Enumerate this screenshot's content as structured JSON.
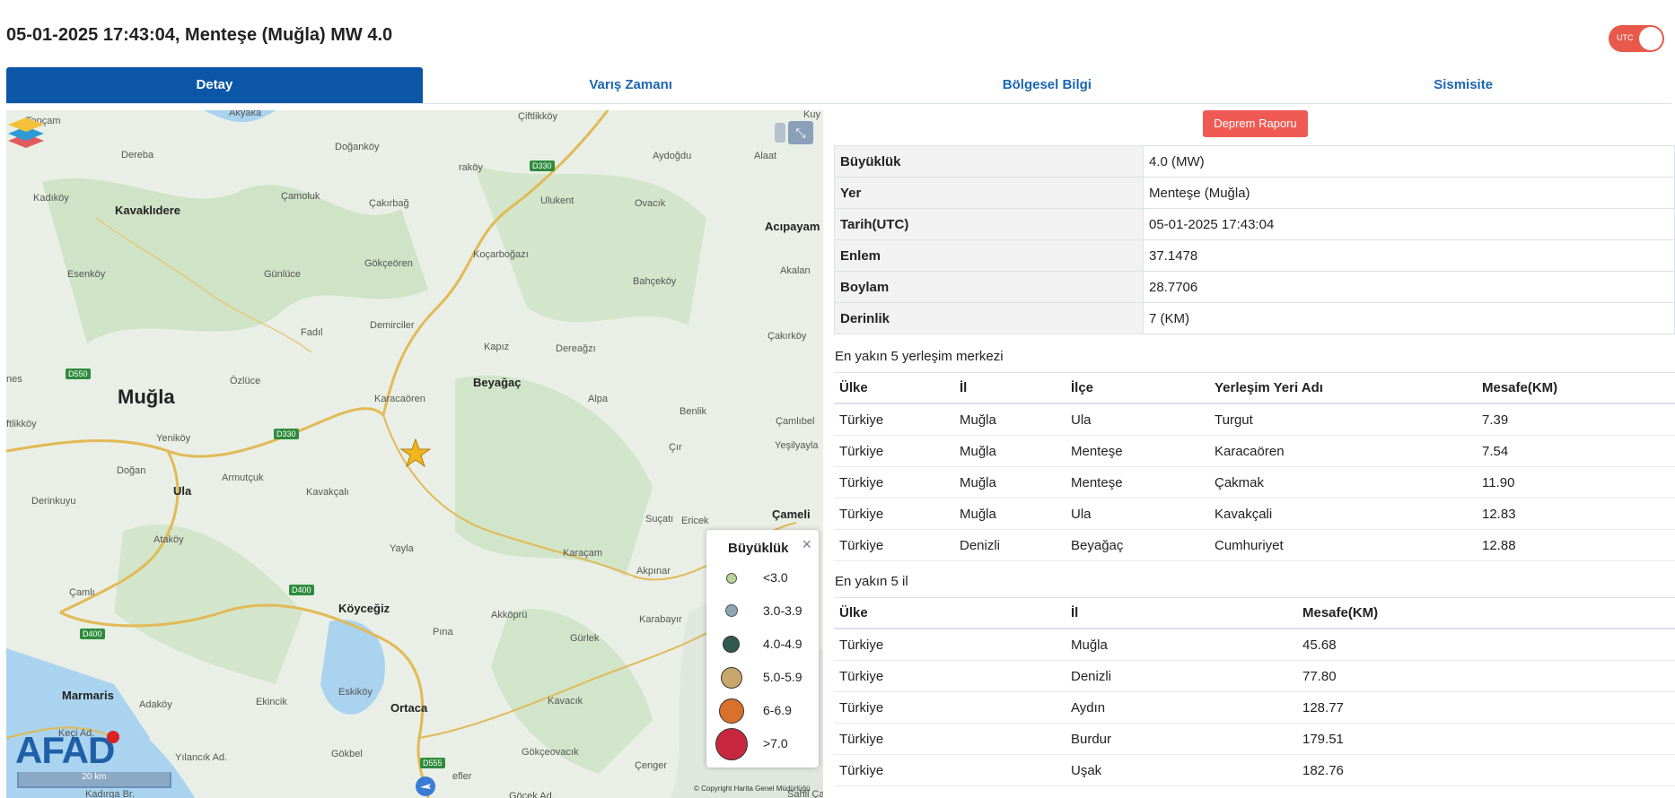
{
  "header": {
    "title": "05-01-2025 17:43:04, Menteşe (Muğla) MW 4.0",
    "utc_label": "UTC"
  },
  "tabs": [
    {
      "label": "Detay",
      "active": true
    },
    {
      "label": "Varış Zamanı",
      "active": false
    },
    {
      "label": "Bölgesel Bilgi",
      "active": false
    },
    {
      "label": "Sismisite",
      "active": false
    }
  ],
  "map": {
    "places": {
      "topcam": "Topçam",
      "akyaka": "Akyaka",
      "ciftlikkoy": "Çiftlikköy",
      "kuyucak": "Kuy",
      "dereba": "Dereba",
      "doganko": "Doğanköy",
      "yarakoy": "raköy",
      "aydogdu": "Aydoğdu",
      "kadikoy": "Kadıköy",
      "kavaklidere": "Kavaklıdere",
      "camoluk": "Çamoluk",
      "cakirbag": "Çakırbağ",
      "ulukent": "Ulukent",
      "ovacik": "Ovacık",
      "alaattin": "Alaat",
      "acipayam": "Acıpayam",
      "gokceoren": "Gökçeören",
      "kocarbogazi": "Koçarboğazı",
      "esenkoy": "Esenköy",
      "gunluce": "Günlüce",
      "bahcekoy": "Bahçeköy",
      "akalan": "Akalan",
      "fadil": "Fadıl",
      "demirciler": "Demirciler",
      "cakirkoy": "Çakırköy",
      "kapiz": "Kapız",
      "dereagzi": "Dereağzı",
      "nes": "nes",
      "ozluce": "Özlüce",
      "beyagac": "Beyağaç",
      "mugla": "Muğla",
      "karacaoren": "Karacaören",
      "alpa": "Alpa",
      "benlik": "Benlik",
      "ciftlikkoy2": "ftlikköy",
      "yenikoy": "Yeniköy",
      "camlibel": "Çamlıbel",
      "yesilyayla": "Yeşilyayla",
      "cir": "Çır",
      "dogan": "Doğan",
      "armutcuk": "Armutçuk",
      "ula": "Ula",
      "kavakcali": "Kavakçalı",
      "derinkuyu": "Derinkuyu",
      "sucati": "Suçatı",
      "ericek": "Ericek",
      "cameli": "Çameli",
      "atakoy": "Ataköy",
      "yayla": "Yayla",
      "karacam": "Karaçam",
      "akpinar": "Akpınar",
      "camli": "Çamlı",
      "koycegiz": "Köyceğiz",
      "akkopru": "Akköprü",
      "karabayir": "Karabayır",
      "pina": "Pına",
      "gurlek": "Gürlek",
      "marmaris": "Marmaris",
      "adakoy": "Adaköy",
      "ekincik": "Ekincik",
      "eskikoy": "Eskiköy",
      "ortaca": "Ortaca",
      "kavacik": "Kavacık",
      "keciad": "Keçi Ad.",
      "yilancikad": "Yılancık Ad.",
      "gokbel": "Gökbel",
      "efler": "efler",
      "gokceovacik": "Gökçeovacık",
      "cenger": "Çenger",
      "kadirgabr": "Kadırga Br.",
      "gocekad": "Göcek Ad.",
      "sabilca": "Sahil Ça"
    },
    "roads": {
      "d330a": "D330",
      "d330b": "D330",
      "d550": "D550",
      "d400a": "D400",
      "d400b": "D400",
      "d555": "D555"
    },
    "scale": "20 km",
    "copyright": "© Copyright Harita Genel Müdürlüğü",
    "logo": "AFAD",
    "legend": {
      "title": "Büyüklük",
      "close": "×",
      "items": [
        {
          "label": "<3.0",
          "color": "#b9d49a"
        },
        {
          "label": "3.0-3.9",
          "color": "#8fa6b3"
        },
        {
          "label": "4.0-4.9",
          "color": "#2f5a4d"
        },
        {
          "label": "5.0-5.9",
          "color": "#c9a66e"
        },
        {
          "label": "6-6.9",
          "color": "#d9702b"
        },
        {
          "label": ">7.0",
          "color": "#c8283f"
        }
      ]
    }
  },
  "report_button": "Deprem Raporu",
  "details": [
    {
      "key": "Büyüklük",
      "value": "4.0 (MW)"
    },
    {
      "key": "Yer",
      "value": "Menteşe (Muğla)"
    },
    {
      "key": "Tarih(UTC)",
      "value": "05-01-2025 17:43:04"
    },
    {
      "key": "Enlem",
      "value": "37.1478"
    },
    {
      "key": "Boylam",
      "value": "28.7706"
    },
    {
      "key": "Derinlik",
      "value": "7 (KM)"
    }
  ],
  "settlements": {
    "title": "En yakın 5 yerleşim merkezi",
    "columns": [
      "Ülke",
      "İl",
      "İlçe",
      "Yerleşim Yeri Adı",
      "Mesafe(KM)"
    ],
    "rows": [
      [
        "Türkiye",
        "Muğla",
        "Ula",
        "Turgut",
        "7.39"
      ],
      [
        "Türkiye",
        "Muğla",
        "Menteşe",
        "Karacaören",
        "7.54"
      ],
      [
        "Türkiye",
        "Muğla",
        "Menteşe",
        "Çakmak",
        "11.90"
      ],
      [
        "Türkiye",
        "Muğla",
        "Ula",
        "Kavakçali",
        "12.83"
      ],
      [
        "Türkiye",
        "Denizli",
        "Beyağaç",
        "Cumhuriyet",
        "12.88"
      ]
    ]
  },
  "provinces": {
    "title": "En yakın 5 il",
    "columns": [
      "Ülke",
      "İl",
      "Mesafe(KM)"
    ],
    "rows": [
      [
        "Türkiye",
        "Muğla",
        "45.68"
      ],
      [
        "Türkiye",
        "Denizli",
        "77.80"
      ],
      [
        "Türkiye",
        "Aydın",
        "128.77"
      ],
      [
        "Türkiye",
        "Burdur",
        "179.51"
      ],
      [
        "Türkiye",
        "Uşak",
        "182.76"
      ]
    ]
  }
}
